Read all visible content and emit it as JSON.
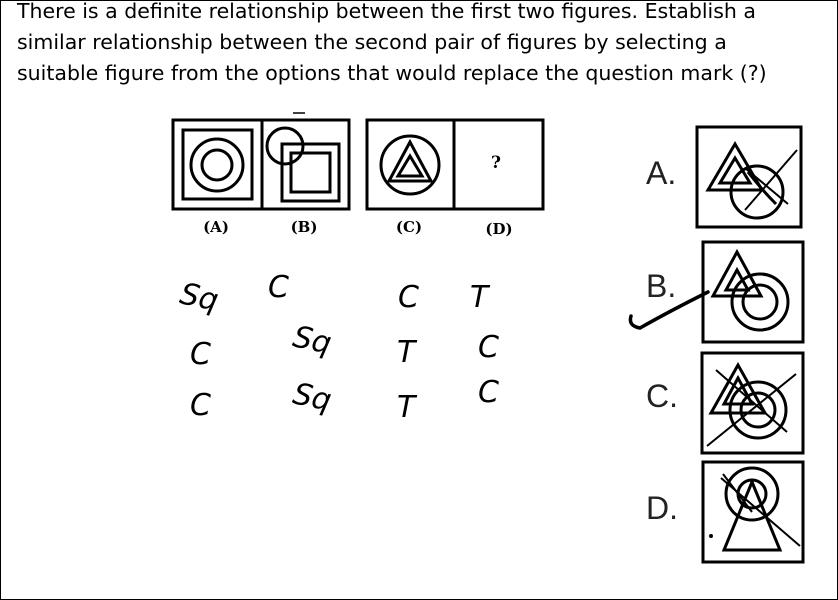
{
  "question": {
    "text": "There is a definite relationship between the first two figures. Establish a\nsimilar relationship between the second pair of figures by selecting a\nsuitable figure from the options that would replace the question mark (?)"
  },
  "figures": {
    "labels": [
      "(A)",
      "(B)",
      "(C)",
      "(D)"
    ],
    "unknown_mark": "?"
  },
  "options": {
    "letters": [
      "A.",
      "B.",
      "C.",
      "D."
    ],
    "crossed_out": [
      "A",
      "C",
      "D"
    ],
    "ticked": "B"
  },
  "notes": {
    "col1": [
      "Sq",
      "C",
      "C"
    ],
    "col2": [
      "C",
      "Sq",
      "Sq"
    ],
    "col3": [
      "C",
      "T",
      "T"
    ],
    "col4": [
      "T",
      "C",
      "C"
    ]
  }
}
